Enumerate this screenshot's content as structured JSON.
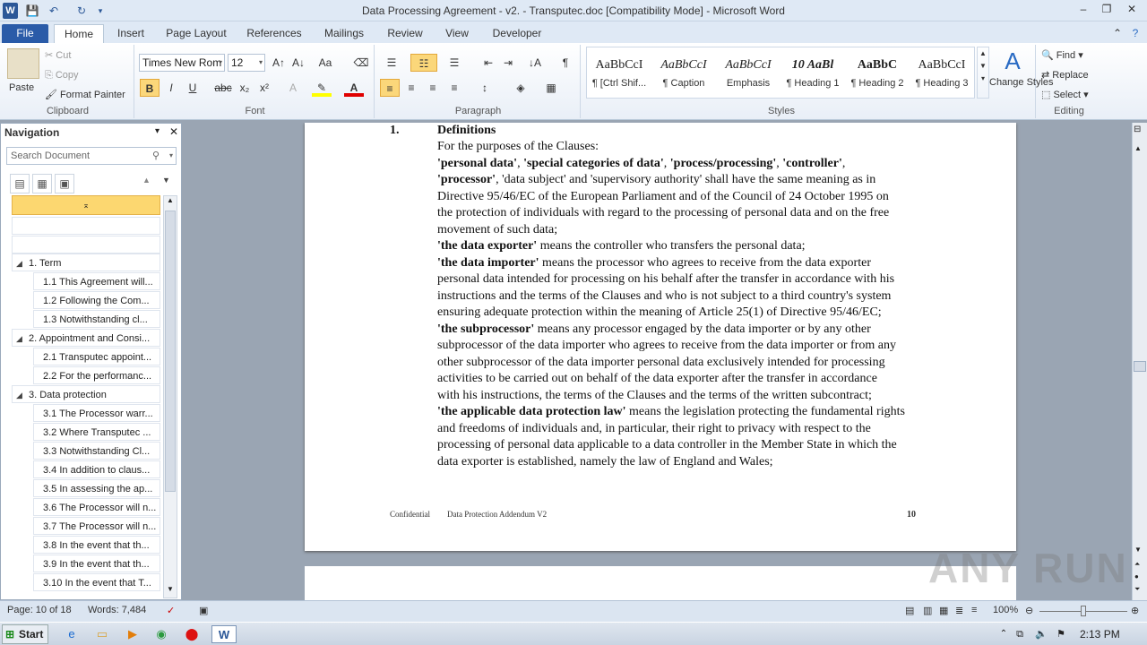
{
  "window": {
    "title": "Data Processing Agreement - v2. - Transputec.doc [Compatibility Mode] - Microsoft Word",
    "app_letter": "W"
  },
  "tabs": [
    "File",
    "Home",
    "Insert",
    "Page Layout",
    "References",
    "Mailings",
    "Review",
    "View",
    "Developer"
  ],
  "clipboard": {
    "paste": "Paste",
    "cut": "Cut",
    "copy": "Copy",
    "format_painter": "Format Painter",
    "label": "Clipboard"
  },
  "font": {
    "name": "Times New Rom",
    "size": "12",
    "label": "Font",
    "bold": "B",
    "italic": "I",
    "underline": "U",
    "strike": "abc",
    "sub": "x₂",
    "sup": "x²"
  },
  "paragraph": {
    "label": "Paragraph"
  },
  "styles": {
    "label": "Styles",
    "items": [
      {
        "sample": "AaBbCcI",
        "name": "¶ [Ctrl Shif..."
      },
      {
        "sample": "AaBbCcI",
        "name": "¶ Caption"
      },
      {
        "sample": "AaBbCcI",
        "name": "Emphasis"
      },
      {
        "sample": "10  AaBl",
        "name": "¶ Heading 1"
      },
      {
        "sample": "AaBbC",
        "name": "¶ Heading 2"
      },
      {
        "sample": "AaBbCcI",
        "name": "¶ Heading 3"
      }
    ],
    "change": "Change Styles"
  },
  "editing": {
    "label": "Editing",
    "find": "Find",
    "replace": "Replace",
    "select": "Select"
  },
  "navigation": {
    "title": "Navigation",
    "search_placeholder": "Search Document",
    "items": [
      {
        "text": "1. Term",
        "level": 1
      },
      {
        "text": "1.1 This Agreement will...",
        "level": 2
      },
      {
        "text": "1.2 Following the Com...",
        "level": 2
      },
      {
        "text": "1.3 Notwithstanding cl...",
        "level": 2
      },
      {
        "text": "2. Appointment and Consi...",
        "level": 1
      },
      {
        "text": "2.1 Transputec appoint...",
        "level": 2
      },
      {
        "text": "2.2 For the performanc...",
        "level": 2
      },
      {
        "text": "3. Data protection",
        "level": 1
      },
      {
        "text": "3.1 The Processor warr...",
        "level": 2
      },
      {
        "text": "3.2 Where Transputec ...",
        "level": 2
      },
      {
        "text": "3.3 Notwithstanding Cl...",
        "level": 2
      },
      {
        "text": "3.4 In addition to claus...",
        "level": 2
      },
      {
        "text": "3.5 In assessing the ap...",
        "level": 2
      },
      {
        "text": "3.6 The Processor will n...",
        "level": 2
      },
      {
        "text": "3.7 The Processor will n...",
        "level": 2
      },
      {
        "text": "3.8 In the event that th...",
        "level": 2
      },
      {
        "text": "3.9 In the event that th...",
        "level": 2
      },
      {
        "text": "3.10 In the event that T...",
        "level": 2
      }
    ]
  },
  "document": {
    "heading_num": "1.",
    "heading": "Definitions",
    "lines": [
      [
        {
          "t": "For the purposes of the Clauses:",
          "b": false
        }
      ],
      [
        {
          "t": "'personal data'",
          "b": true
        },
        {
          "t": ", ",
          "b": false
        },
        {
          "t": "'special categories of data'",
          "b": true
        },
        {
          "t": ", ",
          "b": false
        },
        {
          "t": "'process/processing'",
          "b": true
        },
        {
          "t": ", ",
          "b": false
        },
        {
          "t": "'controller'",
          "b": true
        },
        {
          "t": ",",
          "b": false
        }
      ],
      [
        {
          "t": "'processor'",
          "b": true
        },
        {
          "t": ", 'data subject'",
          "b": false
        },
        {
          "t": " and 'supervisory authority'",
          "b": false
        },
        {
          "t": "  shall have the same meaning as in",
          "b": false
        }
      ],
      [
        {
          "t": "Directive 95/46/EC of the European Parliament and of the Council of 24 October 1995 on",
          "b": false
        }
      ],
      [
        {
          "t": "the protection of individuals with regard to the processing of personal data and on the free",
          "b": false
        }
      ],
      [
        {
          "t": "movement of such data;",
          "b": false
        }
      ],
      [
        {
          "t": "'the data exporter'",
          "b": true
        },
        {
          "t": " means the controller who transfers the personal data;",
          "b": false
        }
      ],
      [
        {
          "t": "'the data importer'",
          "b": true
        },
        {
          "t": "  means the processor who agrees to receive from the data exporter",
          "b": false
        }
      ],
      [
        {
          "t": "personal data intended for processing on his behalf after the transfer in accordance with his",
          "b": false
        }
      ],
      [
        {
          "t": "instructions and the terms of the Clauses and who is not subject to a third country's system",
          "b": false
        }
      ],
      [
        {
          "t": "ensuring adequate protection within the meaning of Article 25(1) of Directive 95/46/EC;",
          "b": false
        }
      ],
      [
        {
          "t": "'the subprocessor'",
          "b": true
        },
        {
          "t": " means any processor engaged by the data importer or by any other",
          "b": false
        }
      ],
      [
        {
          "t": "subprocessor of the data importer who agrees to receive from the data importer or from any",
          "b": false
        }
      ],
      [
        {
          "t": "other subprocessor of the data importer personal data exclusively intended for processing",
          "b": false
        }
      ],
      [
        {
          "t": "activities to be carried out on behalf of the data exporter after the transfer in accordance",
          "b": false
        }
      ],
      [
        {
          "t": "with his instructions, the terms of the Clauses and the terms of the written subcontract;",
          "b": false
        }
      ],
      [
        {
          "t": "'the applicable data protection law'",
          "b": true
        },
        {
          "t": " means the legislation protecting the fundamental rights",
          "b": false
        }
      ],
      [
        {
          "t": "and freedoms of individuals and, in particular, their right to privacy with respect to the",
          "b": false
        }
      ],
      [
        {
          "t": "processing of personal data applicable to a data controller in the Member State in which the",
          "b": false
        }
      ],
      [
        {
          "t": "data exporter is established, namely the law of England and Wales;",
          "b": false
        }
      ]
    ],
    "footer_left": "Confidential",
    "footer_mid": "Data Protection Addendum V2",
    "footer_page": "10"
  },
  "status": {
    "page": "Page: 10 of 18",
    "words": "Words: 7,484",
    "zoom": "100%"
  },
  "taskbar": {
    "start": "Start",
    "time": "2:13 PM"
  },
  "watermark": "ANY RUN"
}
